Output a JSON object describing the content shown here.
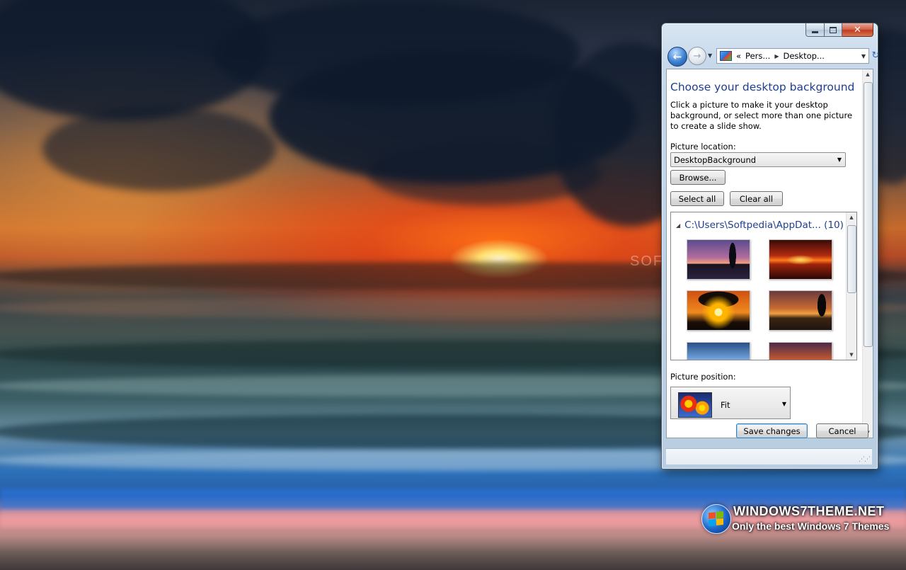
{
  "window": {
    "minimize_icon": "minimize-icon",
    "maximize_icon": "maximize-icon",
    "close_label": "✕"
  },
  "navigation": {
    "back_icon": "back-arrow-icon",
    "forward_icon": "forward-arrow-icon",
    "breadcrumb_chevron": "«",
    "crumbs": [
      "Pers...",
      "Desktop..."
    ],
    "refresh_icon": "refresh-icon"
  },
  "page": {
    "heading": "Choose your desktop background",
    "description": "Click a picture to make it your desktop background, or select more than one picture to create a slide show.",
    "picture_location_label": "Picture location:",
    "picture_location_value": "DesktopBackground",
    "browse_label": "Browse...",
    "select_all_label": "Select all",
    "clear_all_label": "Clear all",
    "gallery": {
      "group_label": "C:\\Users\\Softpedia\\AppDat... (10)",
      "thumbnails": [
        {
          "name": "palm-sunset-purple"
        },
        {
          "name": "red-sunset-sea"
        },
        {
          "name": "tree-sunset-orange"
        },
        {
          "name": "palm-dusk-orange"
        },
        {
          "name": "clouds-blue-sky"
        },
        {
          "name": "sunset-horizon"
        }
      ]
    },
    "picture_position_label": "Picture position:",
    "picture_position_value": "Fit"
  },
  "footer": {
    "save_label": "Save changes",
    "cancel_label": "Cancel"
  },
  "watermark": {
    "title": "WINDOWS7THEME.NET",
    "subtitle": "Only the best Windows 7 Themes",
    "softpedia": "SOFTPEDIA"
  },
  "colors": {
    "heading": "#1e3f8f",
    "window_frame": "#c7d8ea",
    "close_button": "#c13c1f"
  }
}
